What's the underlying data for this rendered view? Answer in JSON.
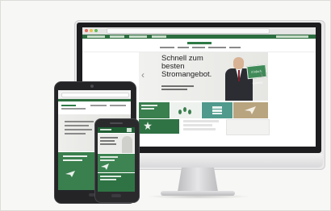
{
  "desktop": {
    "hero_title": "Schnell zum besten Stromangebot.",
    "sign_text": "Einfach. Günstig.",
    "prev_arrow": "‹",
    "next_arrow": "›"
  },
  "colors": {
    "brand_green": "#2c6e3f",
    "tile_green": "#3a7f4e",
    "tile_teal": "#4f9a8c",
    "tile_sand": "#b8a47e"
  },
  "icons": [
    "logo-icon",
    "arrow-left-icon",
    "arrow-right-icon",
    "paper-plane-icon",
    "stack-icon"
  ]
}
